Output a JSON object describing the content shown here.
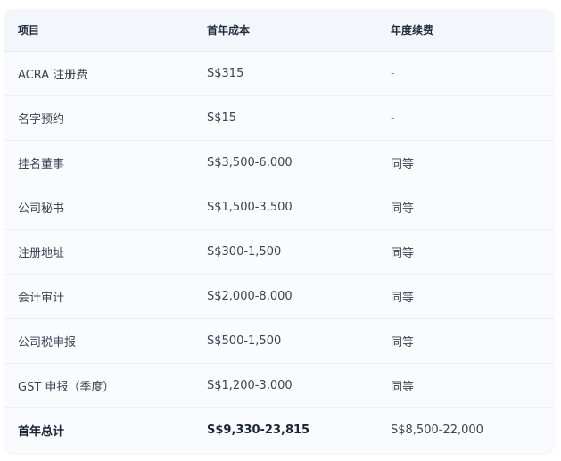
{
  "table": {
    "headers": [
      "项目",
      "首年成本",
      "年度续费"
    ],
    "rows": [
      {
        "item": "ACRA 注册费",
        "first_year": "S$315",
        "renewal": "-"
      },
      {
        "item": "名字预约",
        "first_year": "S$15",
        "renewal": "-"
      },
      {
        "item": "挂名董事",
        "first_year": "S$3,500-6,000",
        "renewal": "同等"
      },
      {
        "item": "公司秘书",
        "first_year": "S$1,500-3,500",
        "renewal": "同等"
      },
      {
        "item": "注册地址",
        "first_year": "S$300-1,500",
        "renewal": "同等"
      },
      {
        "item": "会计审计",
        "first_year": "S$2,000-8,000",
        "renewal": "同等"
      },
      {
        "item": "公司税申报",
        "first_year": "S$500-1,500",
        "renewal": "同等"
      },
      {
        "item": "GST 申报（季度）",
        "first_year": "S$1,200-3,000",
        "renewal": "同等"
      }
    ],
    "total": {
      "item": "首年总计",
      "first_year": "S$9,330-23,815",
      "renewal": "S$8,500-22,000"
    }
  },
  "colors": {
    "card_background": "#f9fbfe",
    "header_background": "#f3f6fb",
    "text": "#3b4454",
    "header_text": "#1f2a3d",
    "row_divider": "#eceff4"
  }
}
